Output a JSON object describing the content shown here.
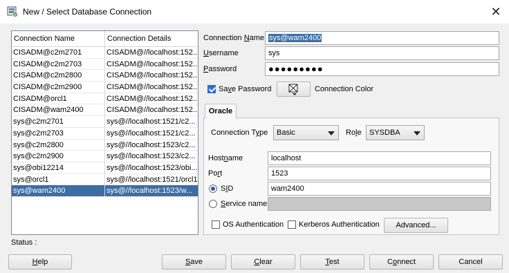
{
  "window": {
    "title": "New / Select Database Connection"
  },
  "connections": {
    "headers": [
      "Connection Name",
      "Connection Details"
    ],
    "rows": [
      [
        "CISADM@c2m2701",
        "CISADM@//localhost:152..."
      ],
      [
        "CISADM@c2m2703",
        "CISADM@//localhost:152..."
      ],
      [
        "CISADM@c2m2800",
        "CISADM@//localhost:152..."
      ],
      [
        "CISADM@c2m2900",
        "CISADM@//localhost:152..."
      ],
      [
        "CISADM@orcl1",
        "CISADM@//localhost:152..."
      ],
      [
        "CISADM@wam2400",
        "CISADM@//localhost:152..."
      ],
      [
        "sys@c2m2701",
        "sys@//localhost:1521/c2..."
      ],
      [
        "sys@c2m2703",
        "sys@//localhost:1521/c2..."
      ],
      [
        "sys@c2m2800",
        "sys@//localhost:1523/c2..."
      ],
      [
        "sys@c2m2900",
        "sys@//localhost:1523/c2..."
      ],
      [
        "sys@obi12214",
        "sys@//localhost:1523/obi..."
      ],
      [
        "sys@orcl1",
        "sys@//localhost:1521/orcl1"
      ],
      [
        "sys@wam2400",
        "sys@//localhost:1523/w..."
      ]
    ],
    "selected_index": 12
  },
  "form": {
    "connection_name_label": "Connection Name",
    "connection_name_value": "sys@wam2400",
    "username_label": "Username",
    "username_value": "sys",
    "password_label": "Password",
    "password_value": "●●●●●●●●●",
    "save_password_label": "Save Password",
    "save_password_checked": true,
    "connection_color_label": "Connection Color"
  },
  "tab": {
    "label": "Oracle"
  },
  "oracle": {
    "connection_type_label": "Connection Type",
    "connection_type_value": "Basic",
    "role_label": "Role",
    "role_value": "SYSDBA",
    "hostname_label": "Hostname",
    "hostname_value": "localhost",
    "port_label": "Port",
    "port_value": "1523",
    "sid_label": "SID",
    "sid_value": "wam2400",
    "service_name_label": "Service name",
    "os_auth_label": "OS Authentication",
    "kerberos_auth_label": "Kerberos Authentication",
    "advanced_label": "Advanced..."
  },
  "status": {
    "label": "Status :"
  },
  "buttons": {
    "help": "Help",
    "save": "Save",
    "clear": "Clear",
    "test": "Test",
    "connect": "Connect",
    "cancel": "Cancel"
  }
}
